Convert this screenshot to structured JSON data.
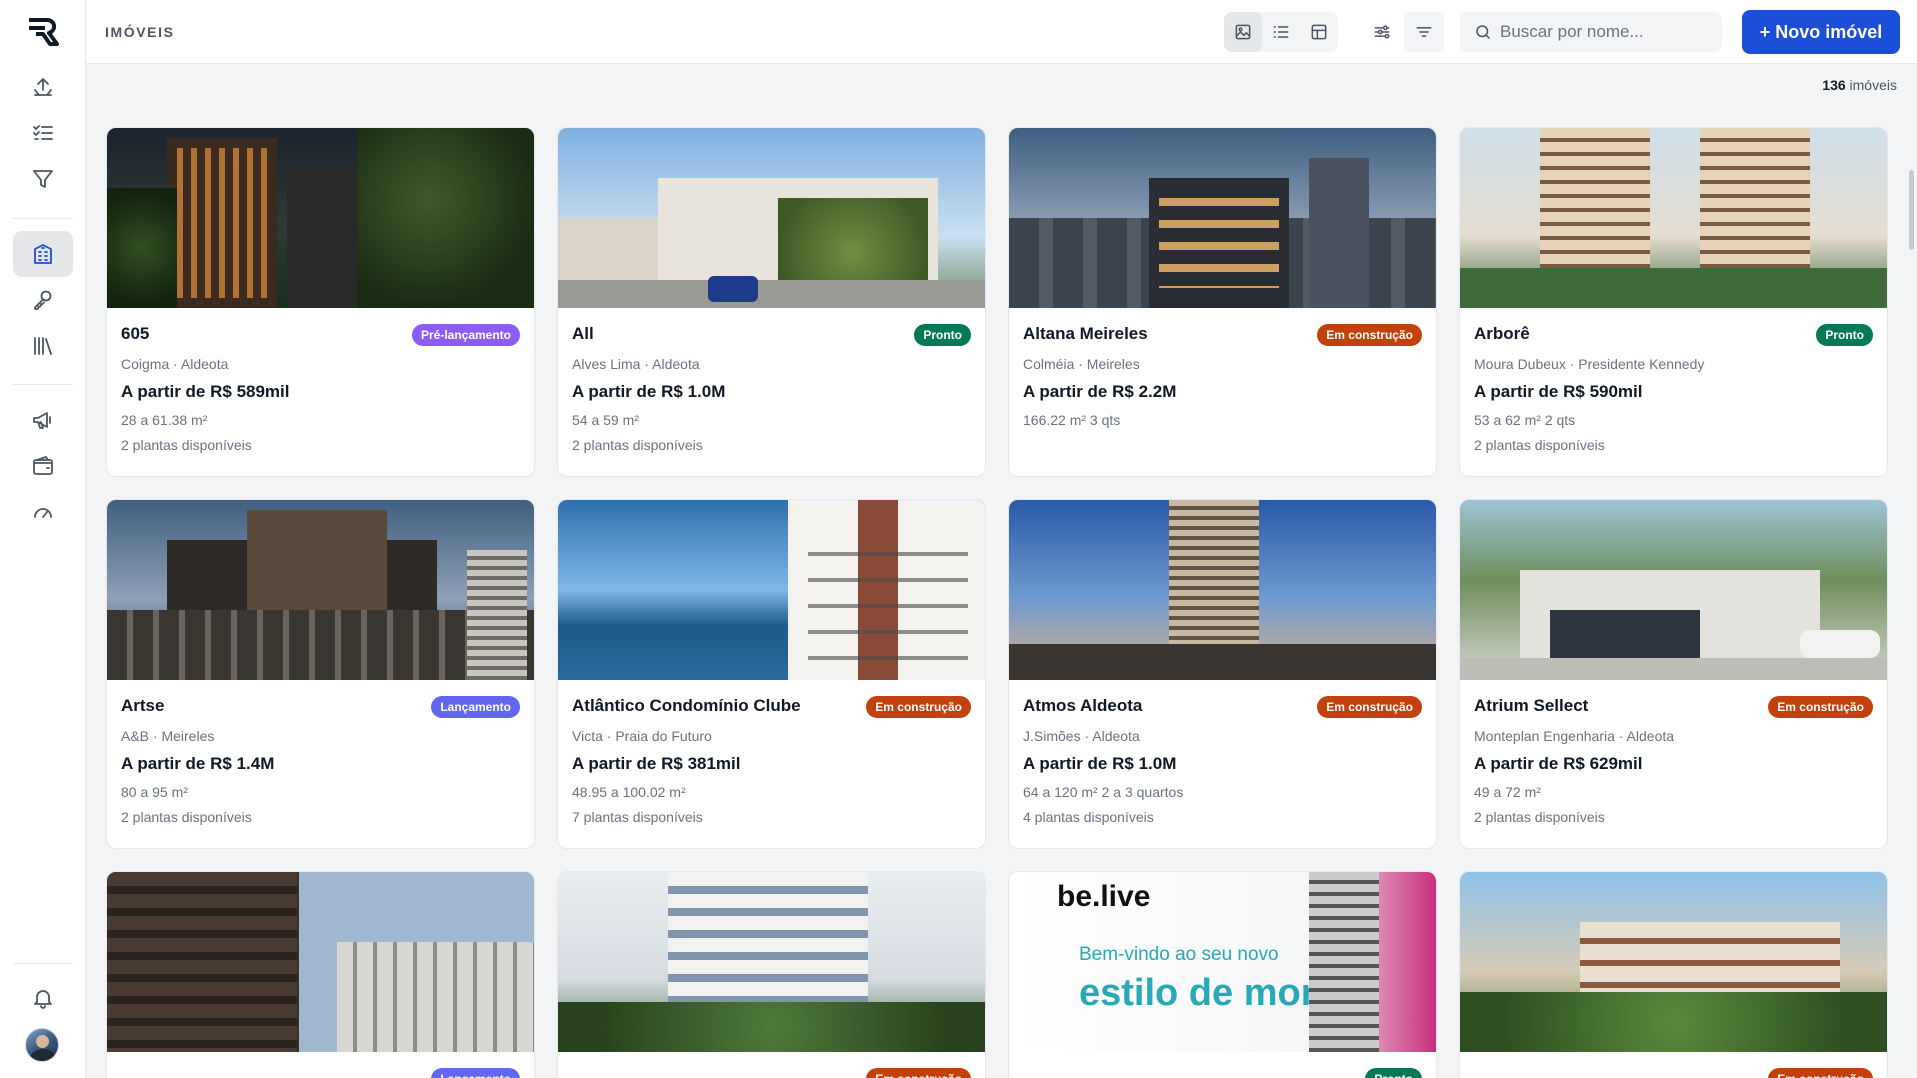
{
  "header": {
    "title": "IMÓVEIS",
    "search_placeholder": "Buscar por nome...",
    "new_button": "+ Novo imóvel"
  },
  "summary": {
    "count": "136",
    "count_label": "imóveis"
  },
  "colors": {
    "primary": "#1d4ed8",
    "pre_lancamento": "#8b5cf6",
    "lancamento": "#6366f1",
    "pronto": "#047857",
    "em_construcao": "#c2410c"
  },
  "icons": {
    "sidebar": [
      "upload-icon",
      "checklist-icon",
      "filter-icon",
      "building-icon",
      "key-icon",
      "library-icon",
      "megaphone-icon",
      "wallet-icon",
      "gauge-icon",
      "bell-icon"
    ],
    "view_modes": [
      "gallery-view-icon",
      "list-view-icon",
      "table-view-icon",
      "sliders-icon"
    ],
    "filter": "filter-lines-icon",
    "search": "search-icon"
  },
  "properties": [
    {
      "name": "605",
      "status": "Pré-lançamento",
      "location": "Coigma · Aldeota",
      "price": "A partir de R$ 589mil",
      "area": "28 a 61.38 m²",
      "plans": "2 plantas disponíveis"
    },
    {
      "name": "All",
      "status": "Pronto",
      "location": "Alves Lima · Aldeota",
      "price": "A partir de R$ 1.0M",
      "area": "54 a 59 m²",
      "plans": "2 plantas disponíveis"
    },
    {
      "name": "Altana Meireles",
      "status": "Em construção",
      "location": "Colméia · Meireles",
      "price": "A partir de R$ 2.2M",
      "area": "166.22 m²   3 qts",
      "plans": ""
    },
    {
      "name": "Arborê",
      "status": "Pronto",
      "location": "Moura Dubeux · Presidente Kennedy",
      "price": "A partir de R$ 590mil",
      "area": "53 a 62 m²   2 qts",
      "plans": "2 plantas disponíveis"
    },
    {
      "name": "Artse",
      "status": "Lançamento",
      "location": "A&B · Meireles",
      "price": "A partir de R$ 1.4M",
      "area": "80 a 95 m²",
      "plans": "2 plantas disponíveis"
    },
    {
      "name": "Atlântico Condomínio Clube",
      "status": "Em construção",
      "location": "Victa · Praia do Futuro",
      "price": "A partir de R$ 381mil",
      "area": "48.95 a 100.02 m²",
      "plans": "7 plantas disponíveis"
    },
    {
      "name": "Atmos Aldeota",
      "status": "Em construção",
      "location": "J.Simões · Aldeota",
      "price": "A partir de R$ 1.0M",
      "area": "64 a 120 m²   2 a 3 quartos",
      "plans": "4 plantas disponíveis"
    },
    {
      "name": "Atrium Sellect",
      "status": "Em construção",
      "location": "Monteplan Engenharia · Aldeota",
      "price": "A partir de R$ 629mil",
      "area": "49 a 72 m²",
      "plans": "2 plantas disponíveis"
    }
  ],
  "partial_row": [
    {
      "status": "Lançamento"
    },
    {
      "status": "Em construção"
    },
    {
      "status": "Pronto",
      "ad_brand": "be.live",
      "ad_line1": "Bem-vindo ao seu novo",
      "ad_line2": "estilo de morar"
    },
    {
      "status": "Em construção"
    }
  ]
}
